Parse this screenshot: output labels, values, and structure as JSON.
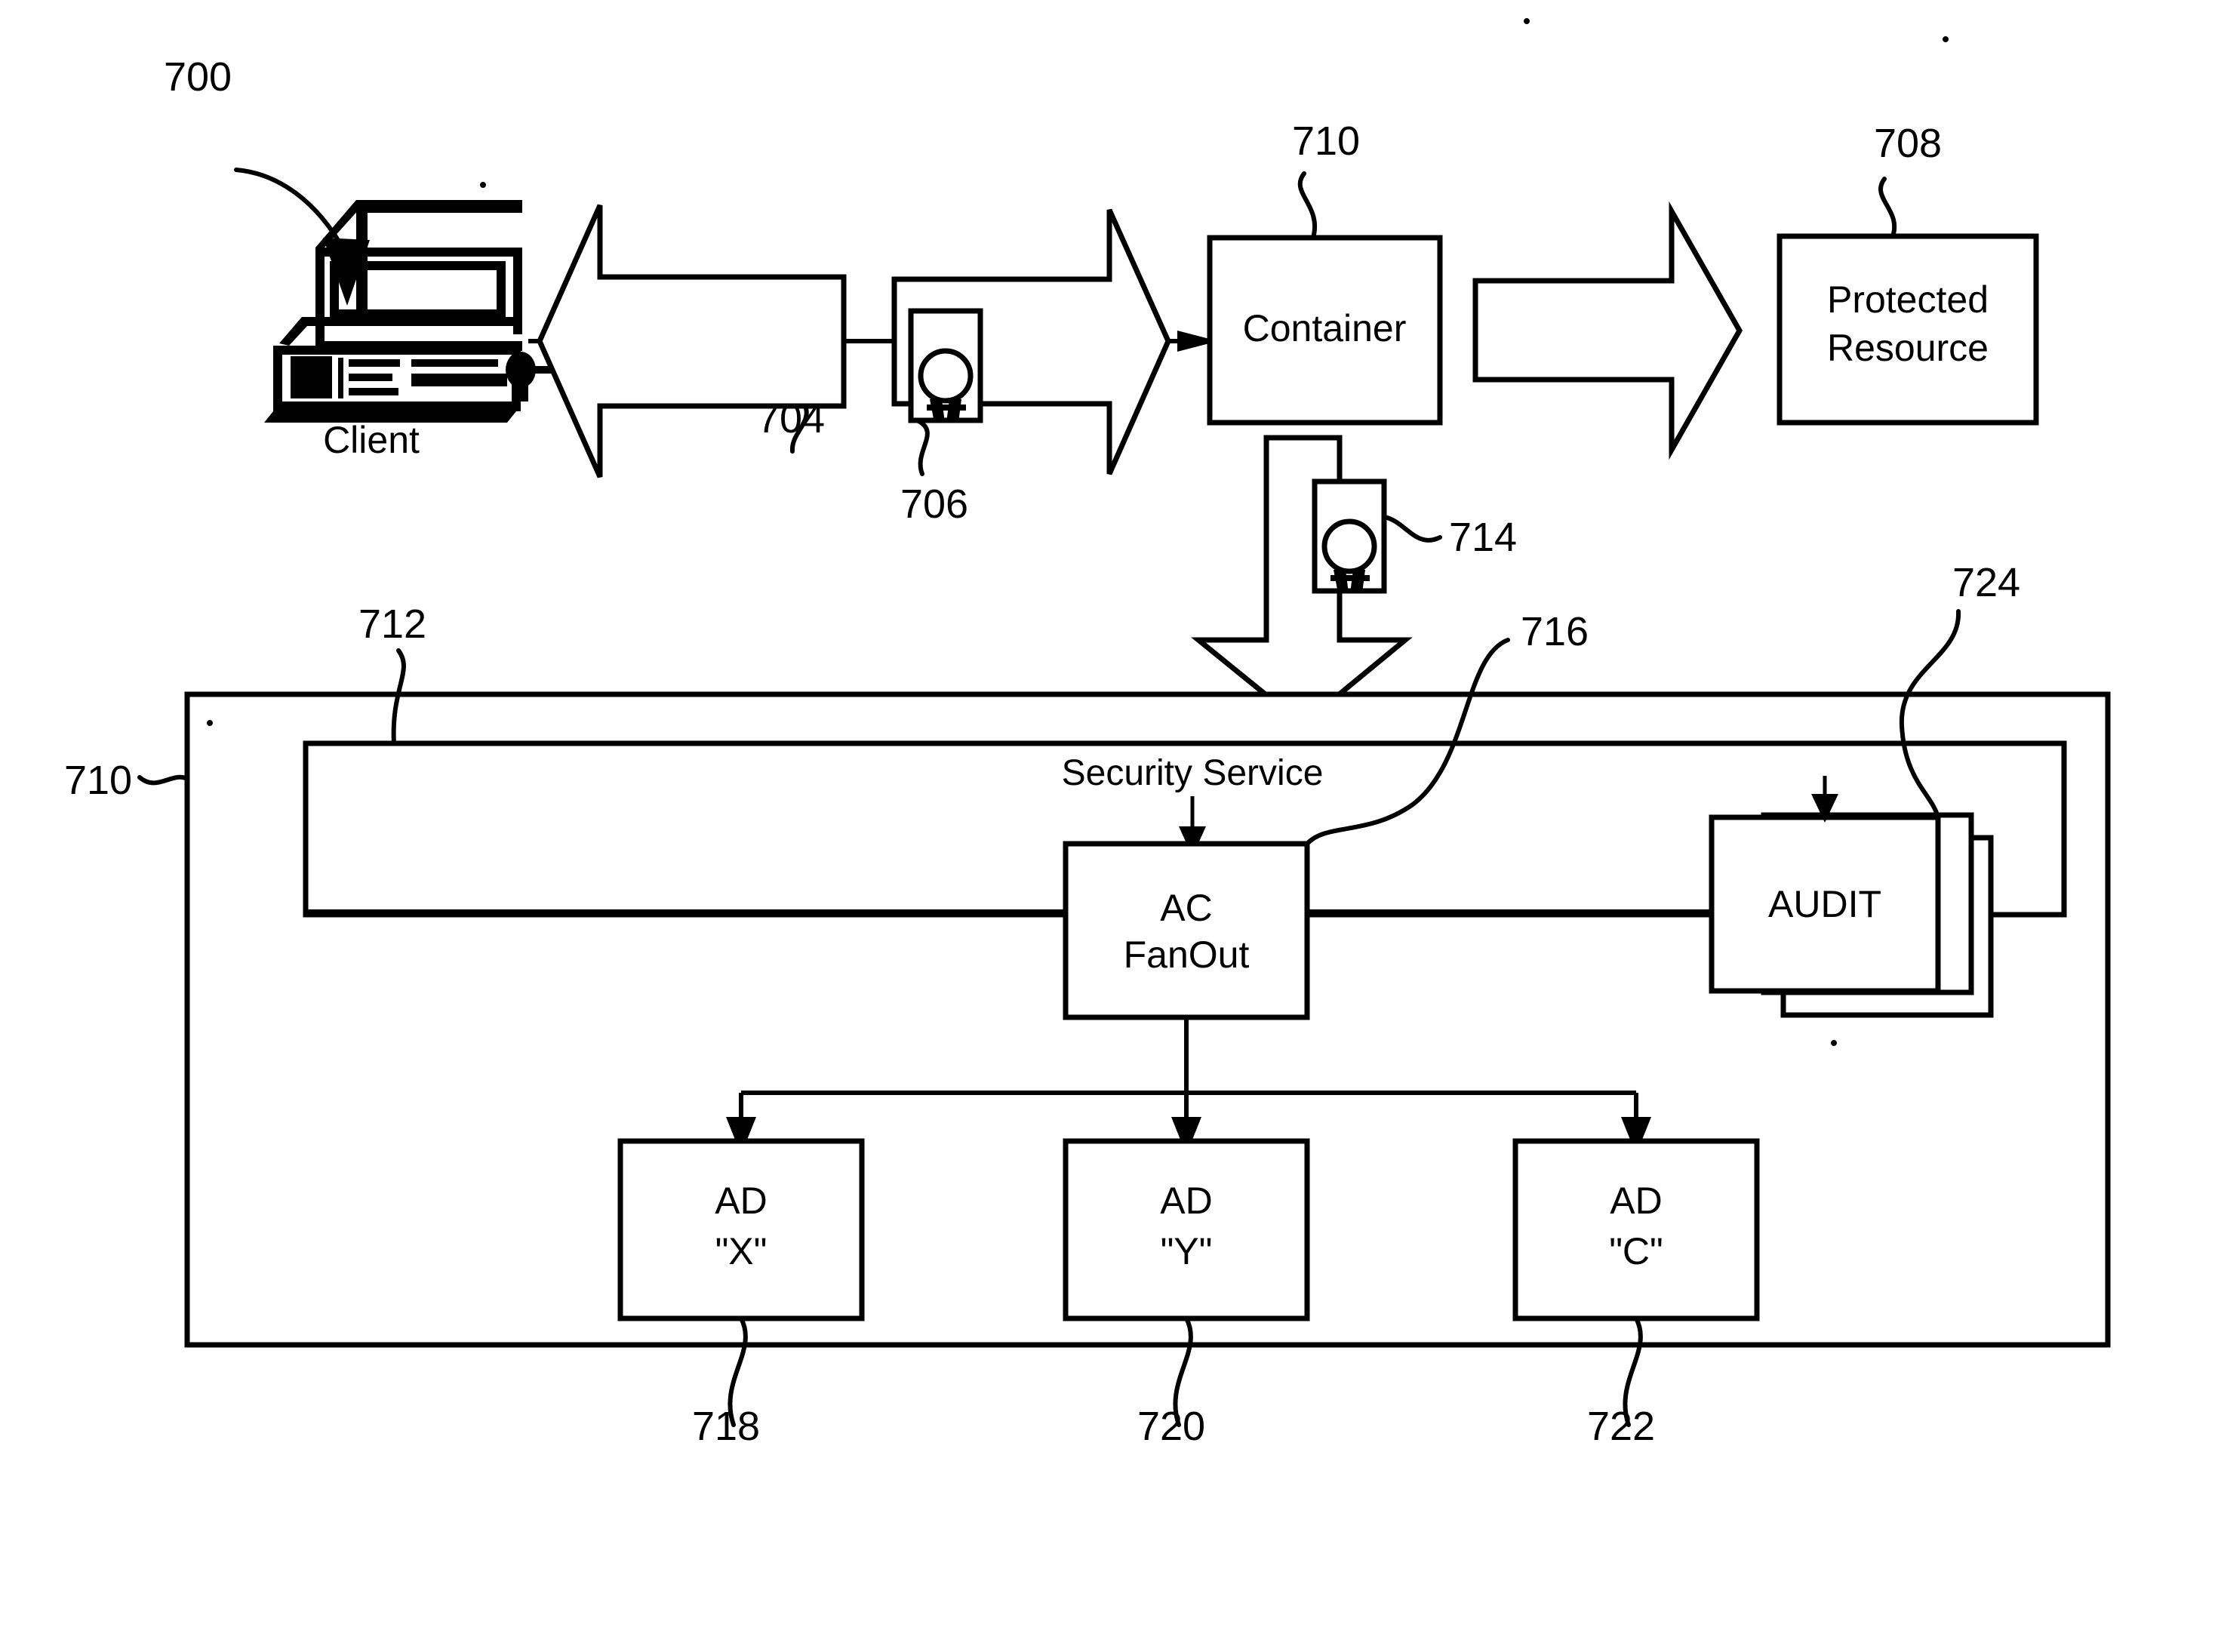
{
  "figure": {
    "number": "700",
    "title_reference": "700"
  },
  "nodes": {
    "client": {
      "label": "Client",
      "icon": "desktop-computer-icon"
    },
    "container_top": {
      "label": "Container",
      "ref": "710"
    },
    "protected_resource": {
      "label_line1": "Protected",
      "label_line2": "Resource",
      "ref": "708"
    },
    "security_service": {
      "label": "Security Service",
      "ref": "712"
    },
    "container_outer": {
      "ref": "710"
    },
    "ac_fanout": {
      "label_line1": "AC",
      "label_line2": "FanOut",
      "ref": "716"
    },
    "audit": {
      "label": "AUDIT",
      "ref": "724"
    },
    "ad_x": {
      "label_line1": "AD",
      "label_line2": "\"X\"",
      "ref": "718"
    },
    "ad_y": {
      "label_line1": "AD",
      "label_line2": "\"Y\"",
      "ref": "720"
    },
    "ad_c": {
      "label_line1": "AD",
      "label_line2": "\"C\"",
      "ref": "722"
    }
  },
  "connectors": {
    "response_arrow": {
      "ref": "704",
      "direction": "left",
      "icon": "block-arrow-left-icon"
    },
    "request_arrow": {
      "direction": "right",
      "icon": "block-arrow-right-icon"
    },
    "resource_arrow": {
      "direction": "right",
      "icon": "block-arrow-right-icon"
    },
    "downward_arrow": {
      "direction": "down",
      "icon": "block-arrow-down-icon"
    },
    "certificate_request": {
      "ref": "706",
      "icon": "certificate-seal-icon"
    },
    "certificate_forwarded": {
      "ref": "714",
      "icon": "certificate-seal-icon"
    }
  },
  "reference_numerals": [
    "700",
    "704",
    "706",
    "708",
    "710",
    "712",
    "714",
    "716",
    "718",
    "720",
    "722",
    "724"
  ],
  "colors": {
    "stroke": "#000000",
    "background": "#ffffff"
  }
}
